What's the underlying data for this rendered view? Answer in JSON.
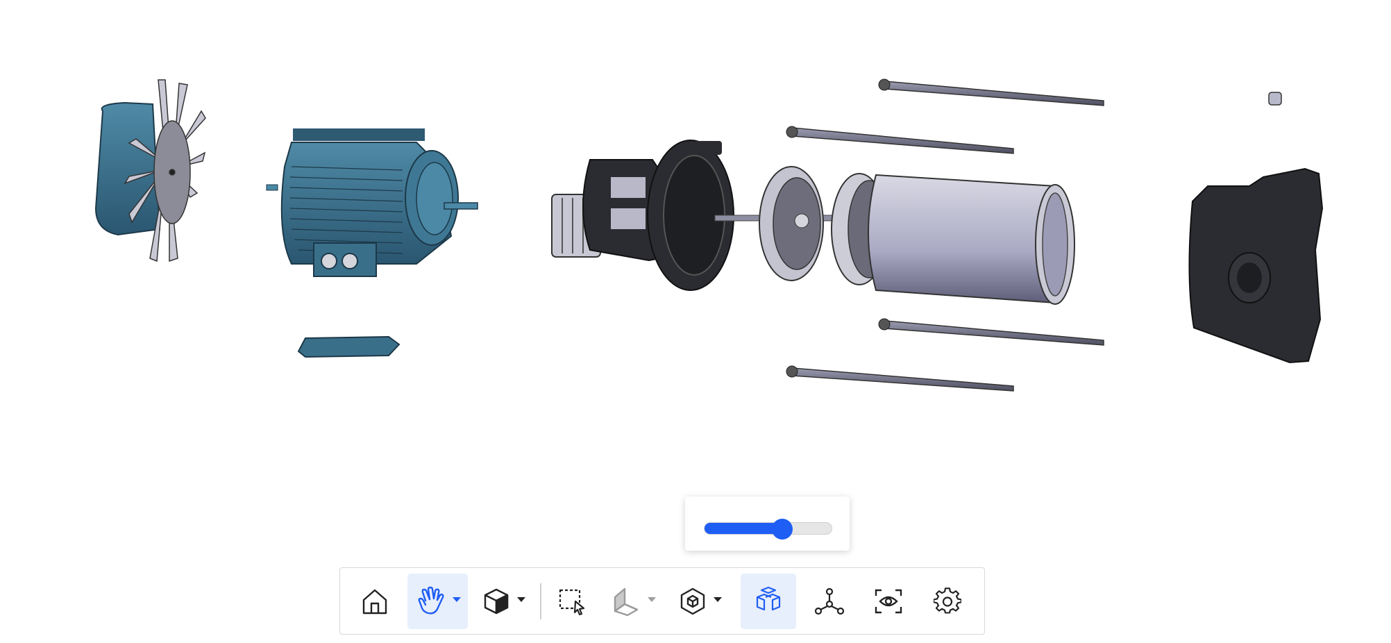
{
  "viewer": {
    "model_parts": [
      "fan-cover",
      "fan",
      "motor",
      "terminal-box-cover",
      "pump-bracket",
      "front-wall",
      "impeller",
      "diffuser",
      "pump-casing",
      "tie-rod",
      "nut",
      "end-cover"
    ]
  },
  "explode_slider": {
    "value_fraction": 0.61
  },
  "toolbar": {
    "items": [
      {
        "icon": "home-icon"
      },
      {
        "icon": "hand-pan-icon",
        "active": true,
        "dropdown": true
      },
      {
        "icon": "cube-view-icon",
        "dropdown": true
      },
      {
        "icon": "box-select-icon"
      },
      {
        "icon": "section-plane-icon",
        "dropdown": true,
        "disabled": true
      },
      {
        "icon": "explode-shaded-icon",
        "dropdown": true
      },
      {
        "icon": "explode-view-icon",
        "active": true
      },
      {
        "icon": "model-tree-icon"
      },
      {
        "icon": "view-focus-icon"
      },
      {
        "icon": "settings-gear-icon"
      }
    ]
  },
  "colors": {
    "accent": "#1f5ef5",
    "active_bg": "#e7eefc",
    "motor": "#3a6f8a",
    "dark_part": "#2b2d33",
    "steel": "#b9b9cc"
  }
}
